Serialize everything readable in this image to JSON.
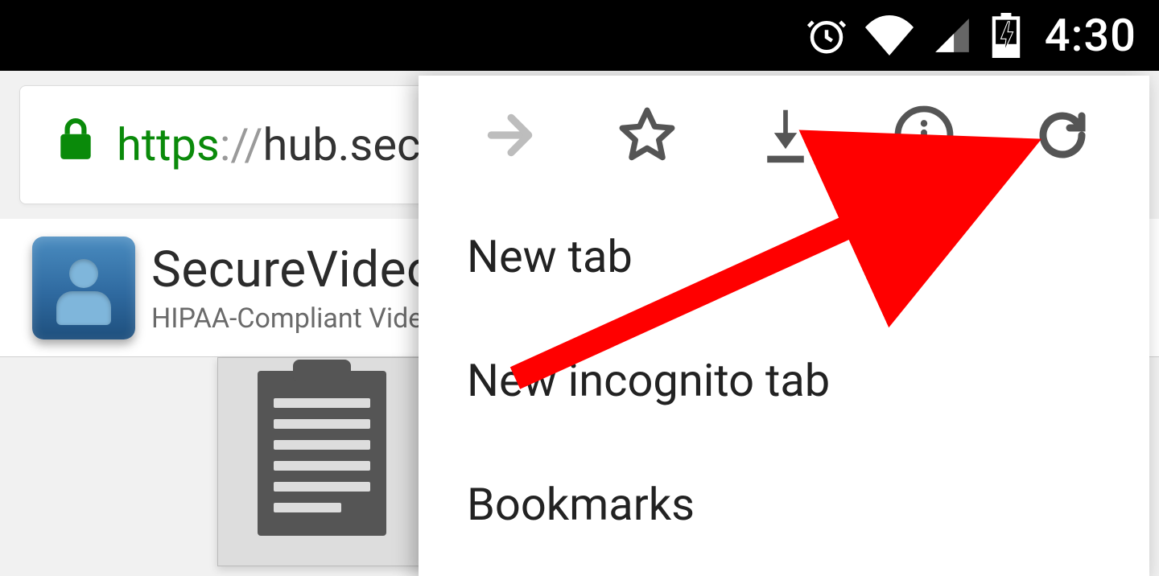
{
  "status_bar": {
    "time": "4:30"
  },
  "address_bar": {
    "protocol": "https",
    "separator": "://",
    "host": "hub.sec"
  },
  "site_header": {
    "title": "SecureVideo",
    "subtitle": "HIPAA-Compliant Videoco"
  },
  "menu": {
    "items": [
      {
        "label": "New tab"
      },
      {
        "label": "New incognito tab"
      },
      {
        "label": "Bookmarks"
      }
    ]
  }
}
